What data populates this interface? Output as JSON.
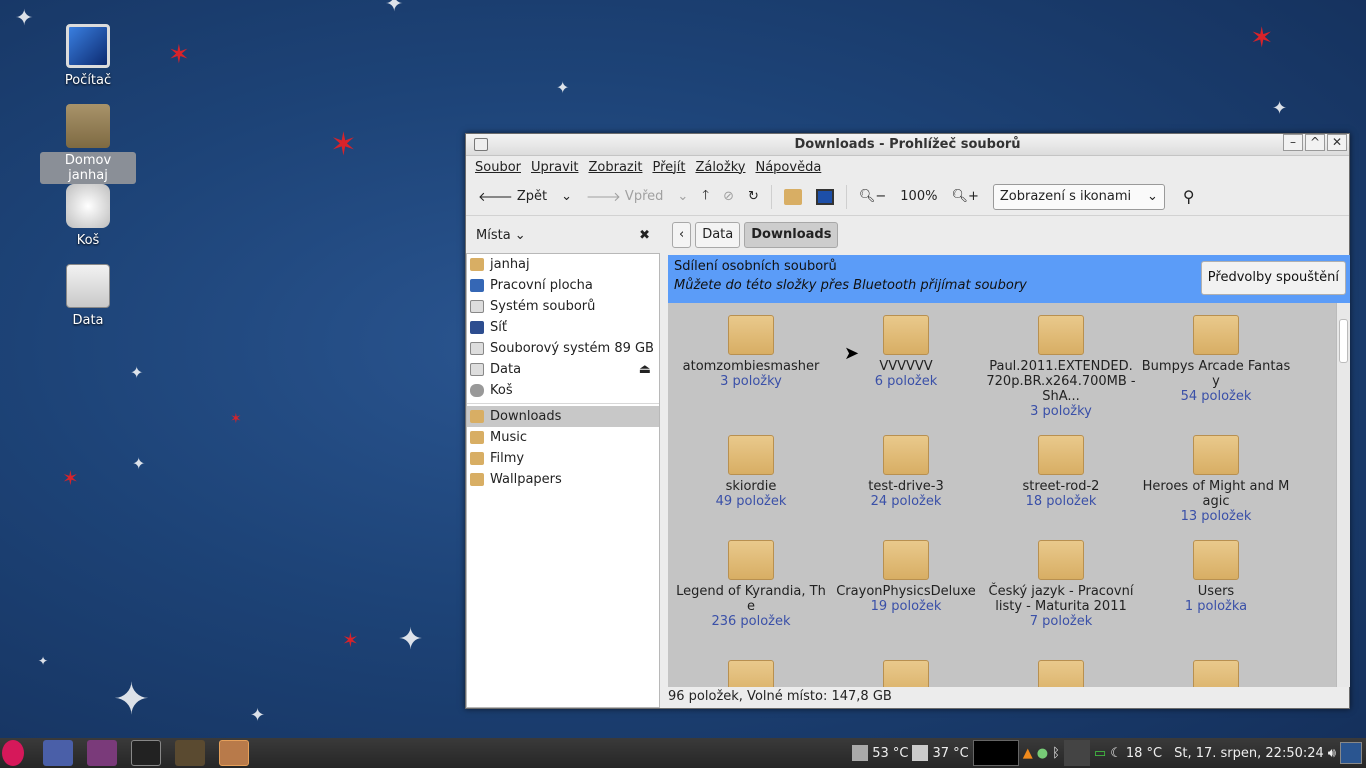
{
  "desktop": {
    "icons": [
      {
        "label": "Počítač",
        "icon": "monitor-icon"
      },
      {
        "label": "Domov janhaj",
        "icon": "home-folder-icon"
      },
      {
        "label": "Koš",
        "icon": "trash-icon"
      },
      {
        "label": "Data",
        "icon": "drive-icon"
      }
    ]
  },
  "window": {
    "title": "Downloads - Prohlížeč souborů",
    "menu": [
      "Soubor",
      "Upravit",
      "Zobrazit",
      "Přejít",
      "Záložky",
      "Nápověda"
    ],
    "toolbar": {
      "back": "Zpět",
      "forward": "Vpřed",
      "zoom": "100%",
      "view_mode": "Zobrazení s ikonami"
    },
    "sidebar": {
      "header": "Místa",
      "places": [
        {
          "label": "janhaj",
          "icon": "home-icon"
        },
        {
          "label": "Pracovní plocha",
          "icon": "desktop-icon"
        },
        {
          "label": "Systém souborů",
          "icon": "drive-icon"
        },
        {
          "label": "Síť",
          "icon": "network-icon"
        },
        {
          "label": "Souborový systém 89 GB",
          "icon": "drive-icon"
        },
        {
          "label": "Data",
          "icon": "drive-icon"
        },
        {
          "label": "Koš",
          "icon": "trash-icon"
        }
      ],
      "bookmarks": [
        {
          "label": "Downloads",
          "icon": "downloads-folder-icon"
        },
        {
          "label": "Music",
          "icon": "music-folder-icon"
        },
        {
          "label": "Filmy",
          "icon": "folder-icon"
        },
        {
          "label": "Wallpapers",
          "icon": "folder-icon"
        }
      ]
    },
    "pathbar": [
      "Data",
      "Downloads"
    ],
    "share": {
      "title": "Sdílení osobních souborů",
      "desc": "Můžete do této složky přes Bluetooth přijímat soubory",
      "button": "Předvolby spouštění"
    },
    "files": [
      {
        "name": "atomzombiesmasher",
        "count": "3 položky"
      },
      {
        "name": "VVVVVV",
        "count": "6 položek"
      },
      {
        "name": "Paul.2011.EXTENDED.720p.BR.x264.700MB - ShA...",
        "count": "3 položky"
      },
      {
        "name": "Bumpys Arcade Fantasy",
        "count": "54 položek"
      },
      {
        "name": "skiordie",
        "count": "49 položek"
      },
      {
        "name": "test-drive-3",
        "count": "24 položek"
      },
      {
        "name": "street-rod-2",
        "count": "18 položek"
      },
      {
        "name": "Heroes of Might and Magic",
        "count": "13 položek"
      },
      {
        "name": "Legend of Kyrandia, The",
        "count": "236 položek"
      },
      {
        "name": "CrayonPhysicsDeluxe",
        "count": "19 položek"
      },
      {
        "name": "Český jazyk - Pracovní listy - Maturita 2011",
        "count": "7 položek"
      },
      {
        "name": "Users",
        "count": "1 položka"
      }
    ],
    "status": "96 položek, Volné místo: 147,8 GB"
  },
  "taskbar": {
    "temp1": "53 °C",
    "temp2": "37 °C",
    "weather": "18 °C",
    "clock": "St, 17. srpen, 22:50:24"
  }
}
